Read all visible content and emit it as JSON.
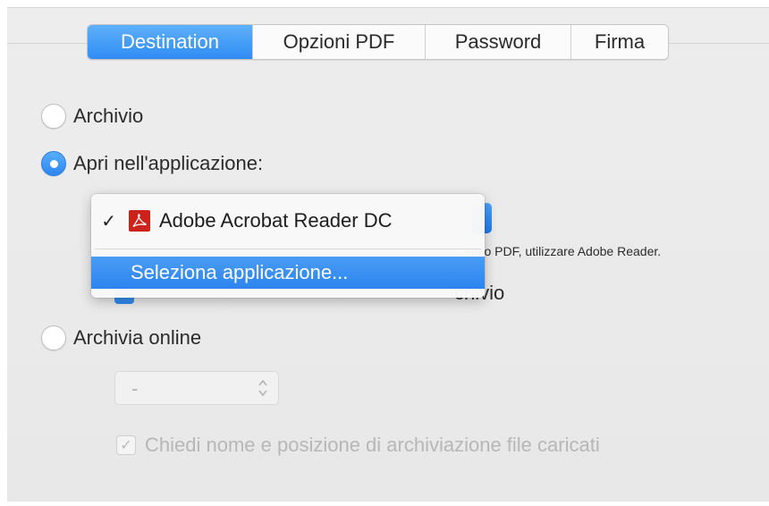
{
  "tabs": [
    {
      "label": "Destination",
      "active": true
    },
    {
      "label": "Opzioni PDF",
      "active": false
    },
    {
      "label": "Password",
      "active": false
    },
    {
      "label": "Firma",
      "active": false
    }
  ],
  "options": {
    "archivio": {
      "label": "Archivio",
      "selected": false
    },
    "apri": {
      "label": "Apri nell'applicazione:",
      "selected": true
    },
    "archivia_online": {
      "label": "Archivia online",
      "selected": false
    }
  },
  "app_popup": {
    "checked_mark": "✓",
    "current_app": "Adobe Acrobat Reader DC",
    "select_app": "Seleziona applicazione...",
    "icon": "pdf-icon"
  },
  "hint_text": "nato PDF, utilizzare Adobe Reader.",
  "partially_hidden_checkbox": {
    "label_visible_tail": "chivio",
    "checked": true
  },
  "online": {
    "stepper_value": "-",
    "ask_checkbox_label": "Chiedi nome e posizione di archiviazione file caricati",
    "ask_checked": true
  },
  "colors": {
    "accent": "#2f8cf3",
    "disabled_text": "#b7b7b7",
    "panel_bg": "#ededed"
  }
}
